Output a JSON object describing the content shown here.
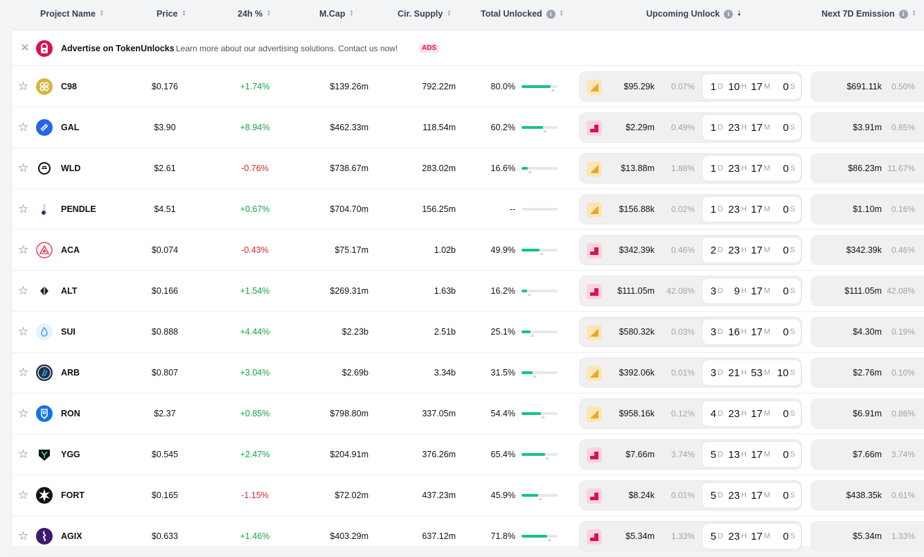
{
  "columns": {
    "project": "Project Name",
    "price": "Price",
    "change": "24h %",
    "mcap": "M.Cap",
    "supply": "Cir. Supply",
    "total_unlocked": "Total Unlocked",
    "upcoming": "Upcoming Unlock",
    "emission": "Next 7D Emission"
  },
  "ad": {
    "title": "Advertise on TokenUnlocks",
    "description": "Learn more about our advertising solutions. Contact us now!",
    "badge": "ADS"
  },
  "colors": {
    "positive": "#16a34a",
    "negative": "#dc2626",
    "progress": "#16c47f",
    "linear_icon": "#e8a72a",
    "cliff_icon": "#d9144a"
  },
  "rows": [
    {
      "name": "C98",
      "icon": "c98-logo",
      "price": "$0.176",
      "change": "+1.74%",
      "dir": "pos",
      "mcap": "$139.26m",
      "supply": "792.22m",
      "unlocked": "80.0%",
      "unlocked_frac": 0.8,
      "type": "linear",
      "up_value": "$95.29k",
      "up_pct": "0.07%",
      "d": "1",
      "h": "10",
      "m": "17",
      "s": "0",
      "em_value": "$691.11k",
      "em_pct": "0.50%"
    },
    {
      "name": "GAL",
      "icon": "gal-logo",
      "price": "$3.90",
      "change": "+8.94%",
      "dir": "pos",
      "mcap": "$462.33m",
      "supply": "118.54m",
      "unlocked": "60.2%",
      "unlocked_frac": 0.602,
      "type": "cliff",
      "up_value": "$2.29m",
      "up_pct": "0.49%",
      "d": "1",
      "h": "23",
      "m": "17",
      "s": "0",
      "em_value": "$3.91m",
      "em_pct": "0.85%"
    },
    {
      "name": "WLD",
      "icon": "wld-logo",
      "price": "$2.61",
      "change": "-0.76%",
      "dir": "neg",
      "mcap": "$738.67m",
      "supply": "283.02m",
      "unlocked": "16.6%",
      "unlocked_frac": 0.166,
      "type": "linear",
      "up_value": "$13.88m",
      "up_pct": "1.88%",
      "d": "1",
      "h": "23",
      "m": "17",
      "s": "0",
      "em_value": "$86.23m",
      "em_pct": "11.67%"
    },
    {
      "name": "PENDLE",
      "icon": "pendle-logo",
      "price": "$4.51",
      "change": "+0.67%",
      "dir": "pos",
      "mcap": "$704.70m",
      "supply": "156.25m",
      "unlocked": "--",
      "unlocked_frac": 0,
      "type": "linear",
      "up_value": "$156.88k",
      "up_pct": "0.02%",
      "d": "1",
      "h": "23",
      "m": "17",
      "s": "0",
      "em_value": "$1.10m",
      "em_pct": "0.16%"
    },
    {
      "name": "ACA",
      "icon": "aca-logo",
      "price": "$0.074",
      "change": "-0.43%",
      "dir": "neg",
      "mcap": "$75.17m",
      "supply": "1.02b",
      "unlocked": "49.9%",
      "unlocked_frac": 0.499,
      "type": "cliff",
      "up_value": "$342.39k",
      "up_pct": "0.46%",
      "d": "2",
      "h": "23",
      "m": "17",
      "s": "0",
      "em_value": "$342.39k",
      "em_pct": "0.46%"
    },
    {
      "name": "ALT",
      "icon": "alt-logo",
      "price": "$0.166",
      "change": "+1.54%",
      "dir": "pos",
      "mcap": "$269.31m",
      "supply": "1.63b",
      "unlocked": "16.2%",
      "unlocked_frac": 0.162,
      "type": "cliff",
      "up_value": "$111.05m",
      "up_pct": "42.08%",
      "d": "3",
      "h": "9",
      "m": "17",
      "s": "0",
      "em_value": "$111.05m",
      "em_pct": "42.08%"
    },
    {
      "name": "SUI",
      "icon": "sui-logo",
      "price": "$0.888",
      "change": "+4.44%",
      "dir": "pos",
      "mcap": "$2.23b",
      "supply": "2.51b",
      "unlocked": "25.1%",
      "unlocked_frac": 0.251,
      "type": "linear",
      "up_value": "$580.32k",
      "up_pct": "0.03%",
      "d": "3",
      "h": "16",
      "m": "17",
      "s": "0",
      "em_value": "$4.30m",
      "em_pct": "0.19%"
    },
    {
      "name": "ARB",
      "icon": "arb-logo",
      "price": "$0.807",
      "change": "+3.04%",
      "dir": "pos",
      "mcap": "$2.69b",
      "supply": "3.34b",
      "unlocked": "31.5%",
      "unlocked_frac": 0.315,
      "type": "linear",
      "up_value": "$392.06k",
      "up_pct": "0.01%",
      "d": "3",
      "h": "21",
      "m": "53",
      "s": "10",
      "em_value": "$2.76m",
      "em_pct": "0.10%"
    },
    {
      "name": "RON",
      "icon": "ron-logo",
      "price": "$2.37",
      "change": "+0.85%",
      "dir": "pos",
      "mcap": "$798.80m",
      "supply": "337.05m",
      "unlocked": "54.4%",
      "unlocked_frac": 0.544,
      "type": "linear",
      "up_value": "$958.16k",
      "up_pct": "0.12%",
      "d": "4",
      "h": "23",
      "m": "17",
      "s": "0",
      "em_value": "$6.91m",
      "em_pct": "0.86%"
    },
    {
      "name": "YGG",
      "icon": "ygg-logo",
      "price": "$0.545",
      "change": "+2.47%",
      "dir": "pos",
      "mcap": "$204.91m",
      "supply": "376.26m",
      "unlocked": "65.4%",
      "unlocked_frac": 0.654,
      "type": "cliff",
      "up_value": "$7.66m",
      "up_pct": "3.74%",
      "d": "5",
      "h": "13",
      "m": "17",
      "s": "0",
      "em_value": "$7.66m",
      "em_pct": "3.74%"
    },
    {
      "name": "FORT",
      "icon": "fort-logo",
      "price": "$0.165",
      "change": "-1.15%",
      "dir": "neg",
      "mcap": "$72.02m",
      "supply": "437.23m",
      "unlocked": "45.9%",
      "unlocked_frac": 0.459,
      "type": "cliff",
      "up_value": "$8.24k",
      "up_pct": "0.01%",
      "d": "5",
      "h": "23",
      "m": "17",
      "s": "0",
      "em_value": "$438.35k",
      "em_pct": "0.61%"
    },
    {
      "name": "AGIX",
      "icon": "agix-logo",
      "price": "$0.633",
      "change": "+1.46%",
      "dir": "pos",
      "mcap": "$403.29m",
      "supply": "637.12m",
      "unlocked": "71.8%",
      "unlocked_frac": 0.718,
      "type": "cliff",
      "up_value": "$5.34m",
      "up_pct": "1.33%",
      "d": "5",
      "h": "23",
      "m": "17",
      "s": "0",
      "em_value": "$5.34m",
      "em_pct": "1.33%"
    }
  ]
}
